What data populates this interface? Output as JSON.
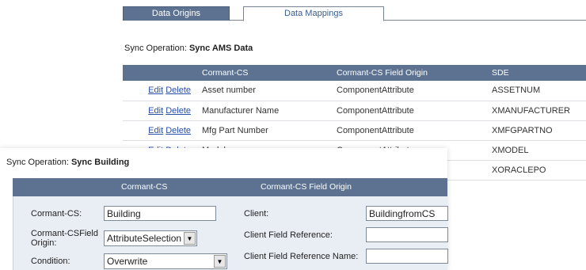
{
  "tabs": [
    {
      "label": "Data Origins"
    },
    {
      "label": "Data Mappings"
    }
  ],
  "back_panel": {
    "sync_label": "Sync Operation:",
    "sync_value": "Sync AMS Data",
    "columns": [
      "Cormant-CS",
      "Cormant-CS Field Origin",
      "SDE"
    ],
    "edit_label": "Edit",
    "delete_label": "Delete",
    "rows": [
      {
        "cs": "Asset number",
        "origin": "ComponentAttribute",
        "sde": "ASSETNUM"
      },
      {
        "cs": "Manufacturer Name",
        "origin": "ComponentAttribute",
        "sde": "XMANUFACTURER"
      },
      {
        "cs": "Mfg Part Number",
        "origin": "ComponentAttribute",
        "sde": "XMFGPARTNO"
      },
      {
        "cs": "Model",
        "origin": "ComponentAttribute",
        "sde": "XMODEL"
      },
      {
        "cs": "",
        "origin": "",
        "sde": "XORACLEPO"
      }
    ]
  },
  "front_panel": {
    "sync_label": "Sync Operation:",
    "sync_value": "Sync Building",
    "header_cs": "Cormant-CS",
    "header_origin": "Cormant-CS Field Origin",
    "fields": {
      "cs_label": "Cormant-CS:",
      "cs_value": "Building",
      "origin_label": "Cormant-CSField Origin:",
      "origin_value": "AttributeSelection",
      "condition_label": "Condition:",
      "condition_value": "Overwrite",
      "client_label": "Client:",
      "client_value": "BuildingfromCS",
      "client_ref_label": "Client Field Reference:",
      "client_ref_value": "",
      "client_ref_name_label": "Client Field Reference Name:",
      "client_ref_name_value": ""
    }
  }
}
